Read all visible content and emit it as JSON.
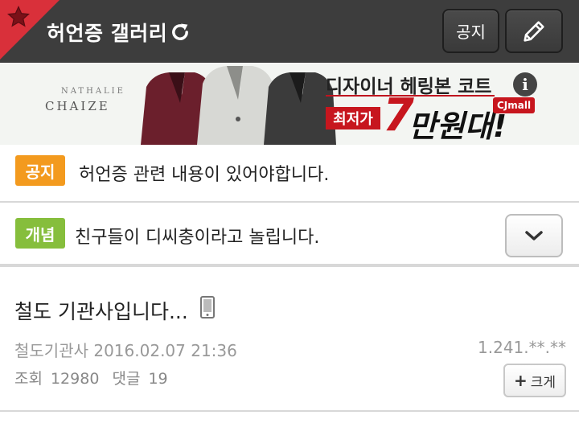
{
  "header": {
    "title": "허언증 갤러리",
    "notice_button": "공지",
    "icons": [
      "star-icon",
      "refresh-icon",
      "pencil-icon"
    ]
  },
  "ad": {
    "brand_top": "NATHALIE",
    "brand": "CHAIZE",
    "headline": "디자이너 헤링본 코트",
    "lowest_label": "최저가",
    "price_number": "7",
    "price_unit": "만원대!",
    "cj_label": "CJmall",
    "info_label": "i"
  },
  "notice_row": {
    "badge": "공지",
    "text": "허언증 관련 내용이 있어야합니다."
  },
  "concept_row": {
    "badge": "개념",
    "text": "친구들이 디씨충이라고 놀립니다."
  },
  "post": {
    "title": "철도 기관사입니다...",
    "author": "철도기관사",
    "datetime": "2016.02.07 21:36",
    "ip": "1.241.**.**",
    "views_label": "조회",
    "views": "12980",
    "comments_label": "댓글",
    "comments": "19",
    "enlarge_label": "크게"
  },
  "colors": {
    "header_bg": "#3d3d3d",
    "corner_red": "#d9303a",
    "notice_badge": "#f39a1e",
    "concept_badge": "#86be3c",
    "ad_red": "#c7161e"
  }
}
